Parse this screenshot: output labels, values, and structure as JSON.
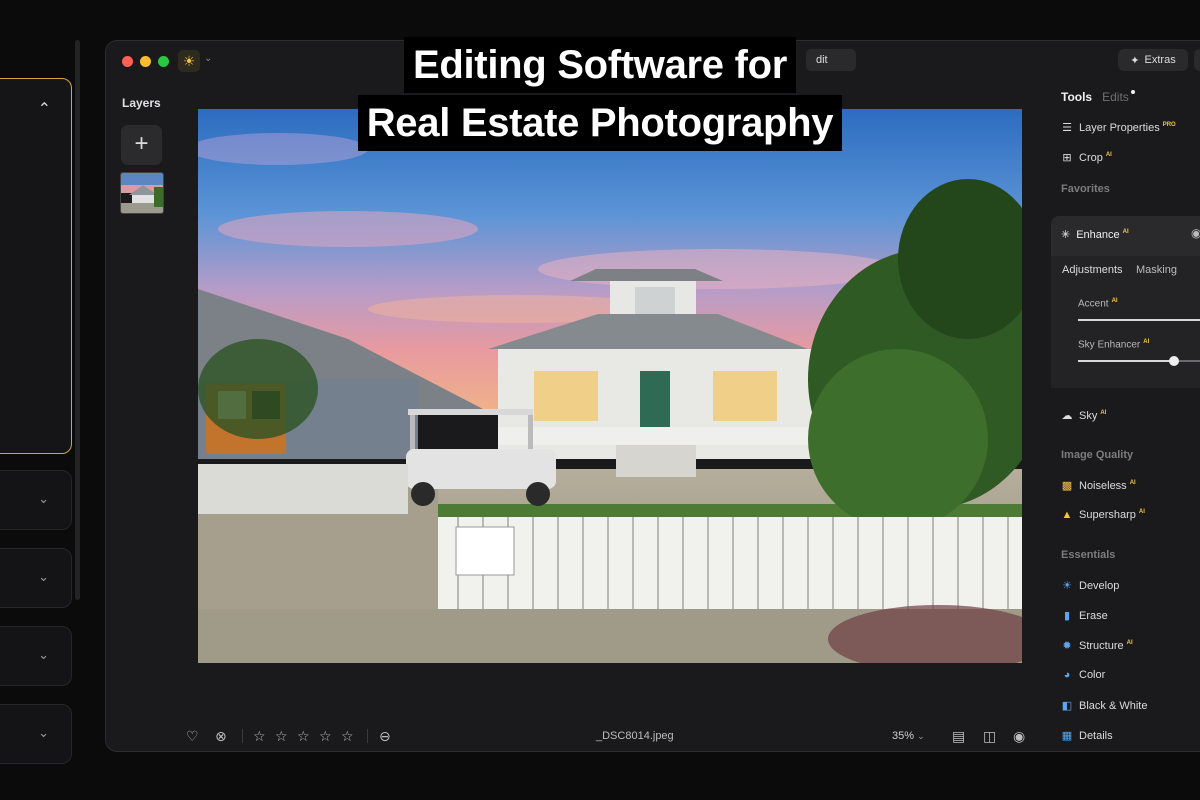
{
  "headline": {
    "line1": "Editing Software for",
    "line2": "Real Estate Photography"
  },
  "window": {
    "edit_tab_label": "dit",
    "extras_label": "Extras"
  },
  "layers": {
    "title": "Layers",
    "add_label": "+"
  },
  "tools": {
    "tabs": [
      {
        "label": "Tools",
        "active": true
      },
      {
        "label": "Edits",
        "active": false
      }
    ],
    "top_items": [
      {
        "label": "Layer Properties",
        "badge": "PRO",
        "icon": "layers-icon"
      },
      {
        "label": "Crop",
        "badge": "AI",
        "icon": "crop-icon"
      }
    ],
    "favorites_title": "Favorites",
    "enhance": {
      "label": "Enhance",
      "badge": "AI",
      "subtabs": [
        "Adjustments",
        "Masking"
      ],
      "sliders": [
        {
          "label": "Accent",
          "badge": "AI",
          "value": 0
        },
        {
          "label": "Sky Enhancer",
          "badge": "AI",
          "value": 0.67
        }
      ]
    },
    "sky": {
      "label": "Sky",
      "badge": "AI"
    },
    "image_quality_title": "Image Quality",
    "image_quality_items": [
      {
        "label": "Noiseless",
        "badge": "AI"
      },
      {
        "label": "Supersharp",
        "badge": "AI"
      }
    ],
    "essentials_title": "Essentials",
    "essentials_items": [
      {
        "label": "Develop",
        "badge": ""
      },
      {
        "label": "Erase",
        "badge": ""
      },
      {
        "label": "Structure",
        "badge": "AI"
      },
      {
        "label": "Color",
        "badge": ""
      },
      {
        "label": "Black & White",
        "badge": ""
      },
      {
        "label": "Details",
        "badge": ""
      }
    ]
  },
  "bottom_bar": {
    "filename": "_DSC8014.jpeg",
    "zoom": "35%"
  },
  "colors": {
    "accent_gold": "#f5c542",
    "panel_bg": "#1a1a1c",
    "selection_border": "#d6a53a"
  }
}
